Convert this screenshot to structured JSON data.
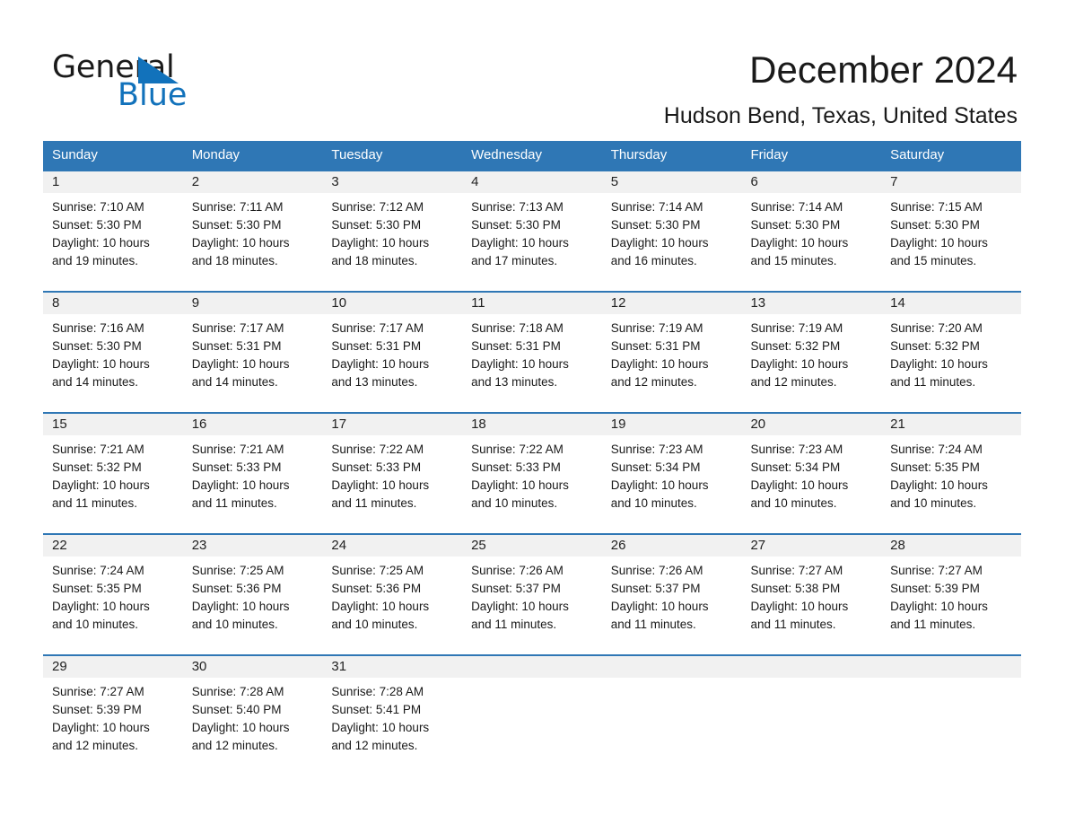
{
  "logo": {
    "word_general": "General",
    "word_blue": "Blue",
    "triangle_color": "#1272bb",
    "blue_text_color": "#1272bb"
  },
  "header": {
    "month_title": "December 2024",
    "location": "Hudson Bend, Texas, United States"
  },
  "theme": {
    "header_blue": "#2f77b5",
    "date_bar_gray": "#f1f1f1",
    "text_dark": "#1a1a1a",
    "page_background": "#ffffff"
  },
  "calendar": {
    "weekday_headers": [
      "Sunday",
      "Monday",
      "Tuesday",
      "Wednesday",
      "Thursday",
      "Friday",
      "Saturday"
    ],
    "weeks": [
      [
        {
          "date": "1",
          "sunrise": "Sunrise: 7:10 AM",
          "sunset": "Sunset: 5:30 PM",
          "daylight_l1": "Daylight: 10 hours",
          "daylight_l2": "and 19 minutes."
        },
        {
          "date": "2",
          "sunrise": "Sunrise: 7:11 AM",
          "sunset": "Sunset: 5:30 PM",
          "daylight_l1": "Daylight: 10 hours",
          "daylight_l2": "and 18 minutes."
        },
        {
          "date": "3",
          "sunrise": "Sunrise: 7:12 AM",
          "sunset": "Sunset: 5:30 PM",
          "daylight_l1": "Daylight: 10 hours",
          "daylight_l2": "and 18 minutes."
        },
        {
          "date": "4",
          "sunrise": "Sunrise: 7:13 AM",
          "sunset": "Sunset: 5:30 PM",
          "daylight_l1": "Daylight: 10 hours",
          "daylight_l2": "and 17 minutes."
        },
        {
          "date": "5",
          "sunrise": "Sunrise: 7:14 AM",
          "sunset": "Sunset: 5:30 PM",
          "daylight_l1": "Daylight: 10 hours",
          "daylight_l2": "and 16 minutes."
        },
        {
          "date": "6",
          "sunrise": "Sunrise: 7:14 AM",
          "sunset": "Sunset: 5:30 PM",
          "daylight_l1": "Daylight: 10 hours",
          "daylight_l2": "and 15 minutes."
        },
        {
          "date": "7",
          "sunrise": "Sunrise: 7:15 AM",
          "sunset": "Sunset: 5:30 PM",
          "daylight_l1": "Daylight: 10 hours",
          "daylight_l2": "and 15 minutes."
        }
      ],
      [
        {
          "date": "8",
          "sunrise": "Sunrise: 7:16 AM",
          "sunset": "Sunset: 5:30 PM",
          "daylight_l1": "Daylight: 10 hours",
          "daylight_l2": "and 14 minutes."
        },
        {
          "date": "9",
          "sunrise": "Sunrise: 7:17 AM",
          "sunset": "Sunset: 5:31 PM",
          "daylight_l1": "Daylight: 10 hours",
          "daylight_l2": "and 14 minutes."
        },
        {
          "date": "10",
          "sunrise": "Sunrise: 7:17 AM",
          "sunset": "Sunset: 5:31 PM",
          "daylight_l1": "Daylight: 10 hours",
          "daylight_l2": "and 13 minutes."
        },
        {
          "date": "11",
          "sunrise": "Sunrise: 7:18 AM",
          "sunset": "Sunset: 5:31 PM",
          "daylight_l1": "Daylight: 10 hours",
          "daylight_l2": "and 13 minutes."
        },
        {
          "date": "12",
          "sunrise": "Sunrise: 7:19 AM",
          "sunset": "Sunset: 5:31 PM",
          "daylight_l1": "Daylight: 10 hours",
          "daylight_l2": "and 12 minutes."
        },
        {
          "date": "13",
          "sunrise": "Sunrise: 7:19 AM",
          "sunset": "Sunset: 5:32 PM",
          "daylight_l1": "Daylight: 10 hours",
          "daylight_l2": "and 12 minutes."
        },
        {
          "date": "14",
          "sunrise": "Sunrise: 7:20 AM",
          "sunset": "Sunset: 5:32 PM",
          "daylight_l1": "Daylight: 10 hours",
          "daylight_l2": "and 11 minutes."
        }
      ],
      [
        {
          "date": "15",
          "sunrise": "Sunrise: 7:21 AM",
          "sunset": "Sunset: 5:32 PM",
          "daylight_l1": "Daylight: 10 hours",
          "daylight_l2": "and 11 minutes."
        },
        {
          "date": "16",
          "sunrise": "Sunrise: 7:21 AM",
          "sunset": "Sunset: 5:33 PM",
          "daylight_l1": "Daylight: 10 hours",
          "daylight_l2": "and 11 minutes."
        },
        {
          "date": "17",
          "sunrise": "Sunrise: 7:22 AM",
          "sunset": "Sunset: 5:33 PM",
          "daylight_l1": "Daylight: 10 hours",
          "daylight_l2": "and 11 minutes."
        },
        {
          "date": "18",
          "sunrise": "Sunrise: 7:22 AM",
          "sunset": "Sunset: 5:33 PM",
          "daylight_l1": "Daylight: 10 hours",
          "daylight_l2": "and 10 minutes."
        },
        {
          "date": "19",
          "sunrise": "Sunrise: 7:23 AM",
          "sunset": "Sunset: 5:34 PM",
          "daylight_l1": "Daylight: 10 hours",
          "daylight_l2": "and 10 minutes."
        },
        {
          "date": "20",
          "sunrise": "Sunrise: 7:23 AM",
          "sunset": "Sunset: 5:34 PM",
          "daylight_l1": "Daylight: 10 hours",
          "daylight_l2": "and 10 minutes."
        },
        {
          "date": "21",
          "sunrise": "Sunrise: 7:24 AM",
          "sunset": "Sunset: 5:35 PM",
          "daylight_l1": "Daylight: 10 hours",
          "daylight_l2": "and 10 minutes."
        }
      ],
      [
        {
          "date": "22",
          "sunrise": "Sunrise: 7:24 AM",
          "sunset": "Sunset: 5:35 PM",
          "daylight_l1": "Daylight: 10 hours",
          "daylight_l2": "and 10 minutes."
        },
        {
          "date": "23",
          "sunrise": "Sunrise: 7:25 AM",
          "sunset": "Sunset: 5:36 PM",
          "daylight_l1": "Daylight: 10 hours",
          "daylight_l2": "and 10 minutes."
        },
        {
          "date": "24",
          "sunrise": "Sunrise: 7:25 AM",
          "sunset": "Sunset: 5:36 PM",
          "daylight_l1": "Daylight: 10 hours",
          "daylight_l2": "and 10 minutes."
        },
        {
          "date": "25",
          "sunrise": "Sunrise: 7:26 AM",
          "sunset": "Sunset: 5:37 PM",
          "daylight_l1": "Daylight: 10 hours",
          "daylight_l2": "and 11 minutes."
        },
        {
          "date": "26",
          "sunrise": "Sunrise: 7:26 AM",
          "sunset": "Sunset: 5:37 PM",
          "daylight_l1": "Daylight: 10 hours",
          "daylight_l2": "and 11 minutes."
        },
        {
          "date": "27",
          "sunrise": "Sunrise: 7:27 AM",
          "sunset": "Sunset: 5:38 PM",
          "daylight_l1": "Daylight: 10 hours",
          "daylight_l2": "and 11 minutes."
        },
        {
          "date": "28",
          "sunrise": "Sunrise: 7:27 AM",
          "sunset": "Sunset: 5:39 PM",
          "daylight_l1": "Daylight: 10 hours",
          "daylight_l2": "and 11 minutes."
        }
      ],
      [
        {
          "date": "29",
          "sunrise": "Sunrise: 7:27 AM",
          "sunset": "Sunset: 5:39 PM",
          "daylight_l1": "Daylight: 10 hours",
          "daylight_l2": "and 12 minutes."
        },
        {
          "date": "30",
          "sunrise": "Sunrise: 7:28 AM",
          "sunset": "Sunset: 5:40 PM",
          "daylight_l1": "Daylight: 10 hours",
          "daylight_l2": "and 12 minutes."
        },
        {
          "date": "31",
          "sunrise": "Sunrise: 7:28 AM",
          "sunset": "Sunset: 5:41 PM",
          "daylight_l1": "Daylight: 10 hours",
          "daylight_l2": "and 12 minutes."
        },
        {
          "date": "",
          "sunrise": "",
          "sunset": "",
          "daylight_l1": "",
          "daylight_l2": ""
        },
        {
          "date": "",
          "sunrise": "",
          "sunset": "",
          "daylight_l1": "",
          "daylight_l2": ""
        },
        {
          "date": "",
          "sunrise": "",
          "sunset": "",
          "daylight_l1": "",
          "daylight_l2": ""
        },
        {
          "date": "",
          "sunrise": "",
          "sunset": "",
          "daylight_l1": "",
          "daylight_l2": ""
        }
      ]
    ]
  }
}
